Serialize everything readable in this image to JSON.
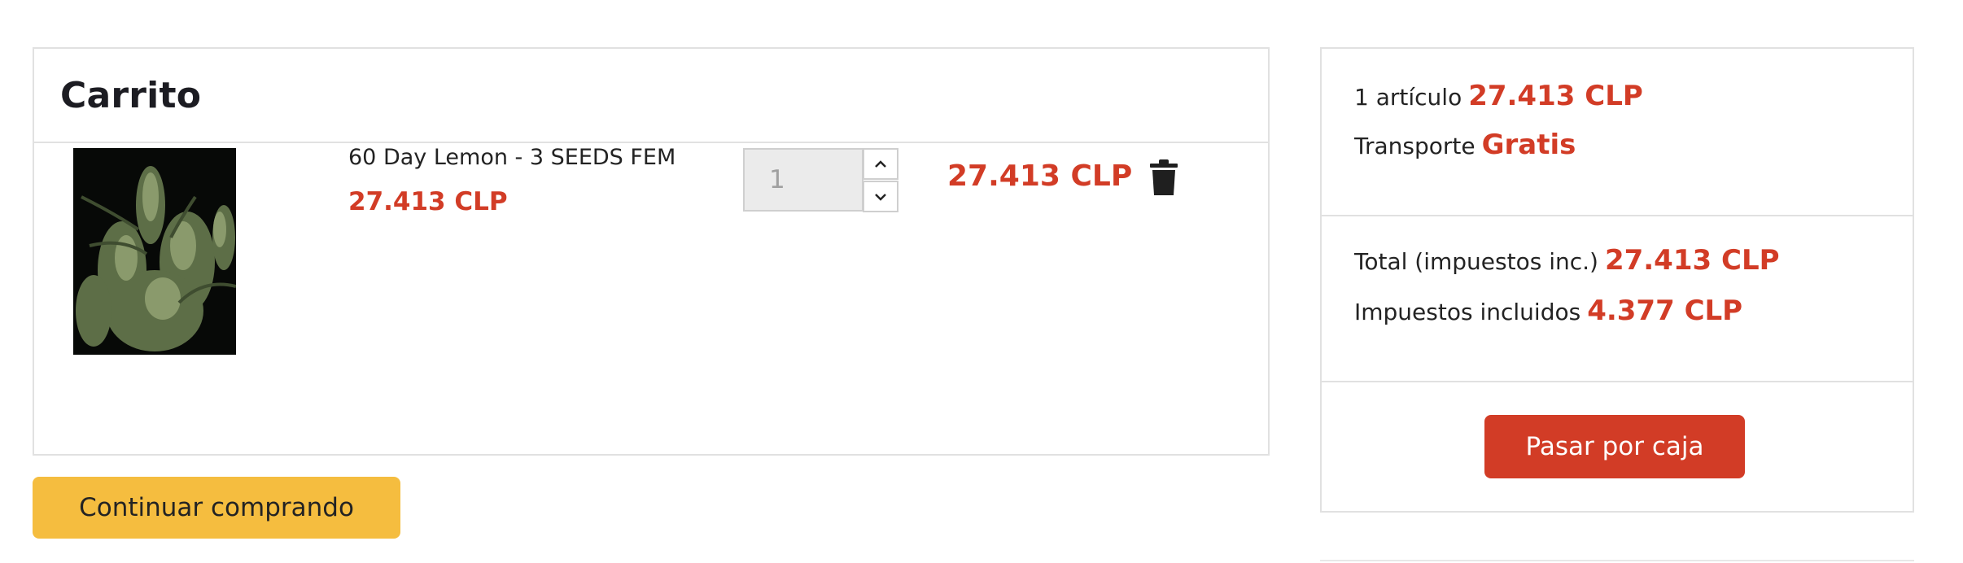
{
  "cart": {
    "title": "Carrito",
    "items": [
      {
        "name": "60 Day Lemon - 3 SEEDS FEM",
        "unit_price": "27.413 CLP",
        "quantity": "1",
        "line_total": "27.413 CLP",
        "image_icon": "cannabis-plant-photo"
      }
    ]
  },
  "actions": {
    "continue_label": "Continuar comprando",
    "checkout_label": "Pasar por caja"
  },
  "summary": {
    "items_label": "1 artículo",
    "items_value": "27.413 CLP",
    "shipping_label": "Transporte",
    "shipping_value": "Gratis",
    "total_label": "Total (impuestos inc.)",
    "total_value": "27.413 CLP",
    "taxes_label": "Impuestos incluidos",
    "taxes_value": "4.377 CLP"
  },
  "colors": {
    "accent": "#d23c26",
    "continue_button": "#f5bd3f",
    "border": "#e1e1e1"
  },
  "icons": {
    "qty_up": "chevron-up-icon",
    "qty_down": "chevron-down-icon",
    "delete": "trash-icon"
  }
}
